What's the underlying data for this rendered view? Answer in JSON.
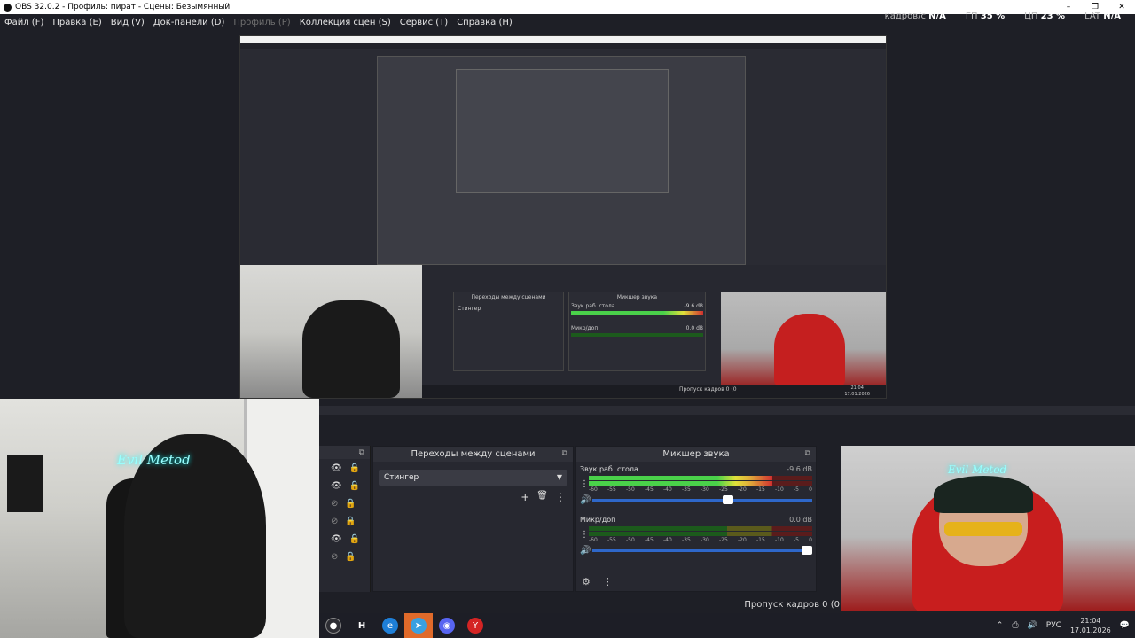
{
  "window": {
    "title": "OBS 32.0.2 - Профиль: пират - Сцены: Безымянный",
    "controls": {
      "minimize": "–",
      "maximize": "❐",
      "close": "✕"
    }
  },
  "menu": {
    "items": [
      {
        "label": "Файл (F)",
        "enabled": true
      },
      {
        "label": "Правка (E)",
        "enabled": true
      },
      {
        "label": "Вид (V)",
        "enabled": true
      },
      {
        "label": "Док-панели (D)",
        "enabled": true
      },
      {
        "label": "Профиль (P)",
        "enabled": false
      },
      {
        "label": "Коллекция сцен (S)",
        "enabled": true
      },
      {
        "label": "Сервис (T)",
        "enabled": true
      },
      {
        "label": "Справка (H)",
        "enabled": true
      }
    ]
  },
  "stats": {
    "fps_label": "кадров/с",
    "fps_value": "N/A",
    "gpu_label": "ГП",
    "gpu_value": "35 %",
    "cpu_label": "ЦП",
    "cpu_value": "23 %",
    "lat_label": "LAT",
    "lat_value": "N/A"
  },
  "preview": {
    "transitions_title": "Переходы между сценами",
    "transition_value": "Стингер",
    "mixer_title": "Микшер звука",
    "track1_name": "Звук раб. стола",
    "track1_db": "-9.6 dB",
    "track2_name": "Микр/доп",
    "track2_db": "0.0 dB",
    "dropped_frames": "Пропуск кадров 0 (0",
    "clock_time": "21:04",
    "clock_date": "17.01.2026",
    "webcam_neon": "Evil Metod"
  },
  "sources": {
    "rows": [
      {
        "visible": true,
        "locked": true
      },
      {
        "visible": true,
        "locked": true
      },
      {
        "visible": false,
        "locked": true
      },
      {
        "visible": false,
        "locked": true
      },
      {
        "visible": true,
        "locked": true
      },
      {
        "visible": false,
        "locked": true
      }
    ]
  },
  "transitions": {
    "title": "Переходы между сценами",
    "selected": "Стингер",
    "icons": {
      "add": "+",
      "remove": "🗑",
      "more": "⋮"
    }
  },
  "mixer": {
    "title": "Микшер звука",
    "scale": [
      "-60",
      "-55",
      "-50",
      "-45",
      "-40",
      "-35",
      "-30",
      "-25",
      "-20",
      "-15",
      "-10",
      "-5",
      "0"
    ],
    "tracks": [
      {
        "name": "Звук раб. стола",
        "db": "-9.6 dB",
        "level": 0.82,
        "fader": 0.64
      },
      {
        "name": "Микр/доп",
        "db": "0.0 dB",
        "level": 0.0,
        "fader": 1.0
      }
    ]
  },
  "status": {
    "dropped": "Пропуск кадров 0 (0"
  },
  "taskbar": {
    "apps": [
      {
        "name": "obs-icon",
        "glyph": "●",
        "color": "#2d2d33"
      },
      {
        "name": "hamster-icon",
        "glyph": "H",
        "color": "#1d1e26"
      },
      {
        "name": "edge-icon",
        "glyph": "e",
        "color": "#1e7fd8"
      },
      {
        "name": "telegram-icon",
        "glyph": "➤",
        "color": "#3aa0e0"
      },
      {
        "name": "discord-icon",
        "glyph": "◉",
        "color": "#5865f2"
      },
      {
        "name": "yandex-icon",
        "glyph": "Y",
        "color": "#d42424"
      }
    ],
    "lang": "РУС",
    "time": "21:04",
    "date": "17.01.2026"
  }
}
